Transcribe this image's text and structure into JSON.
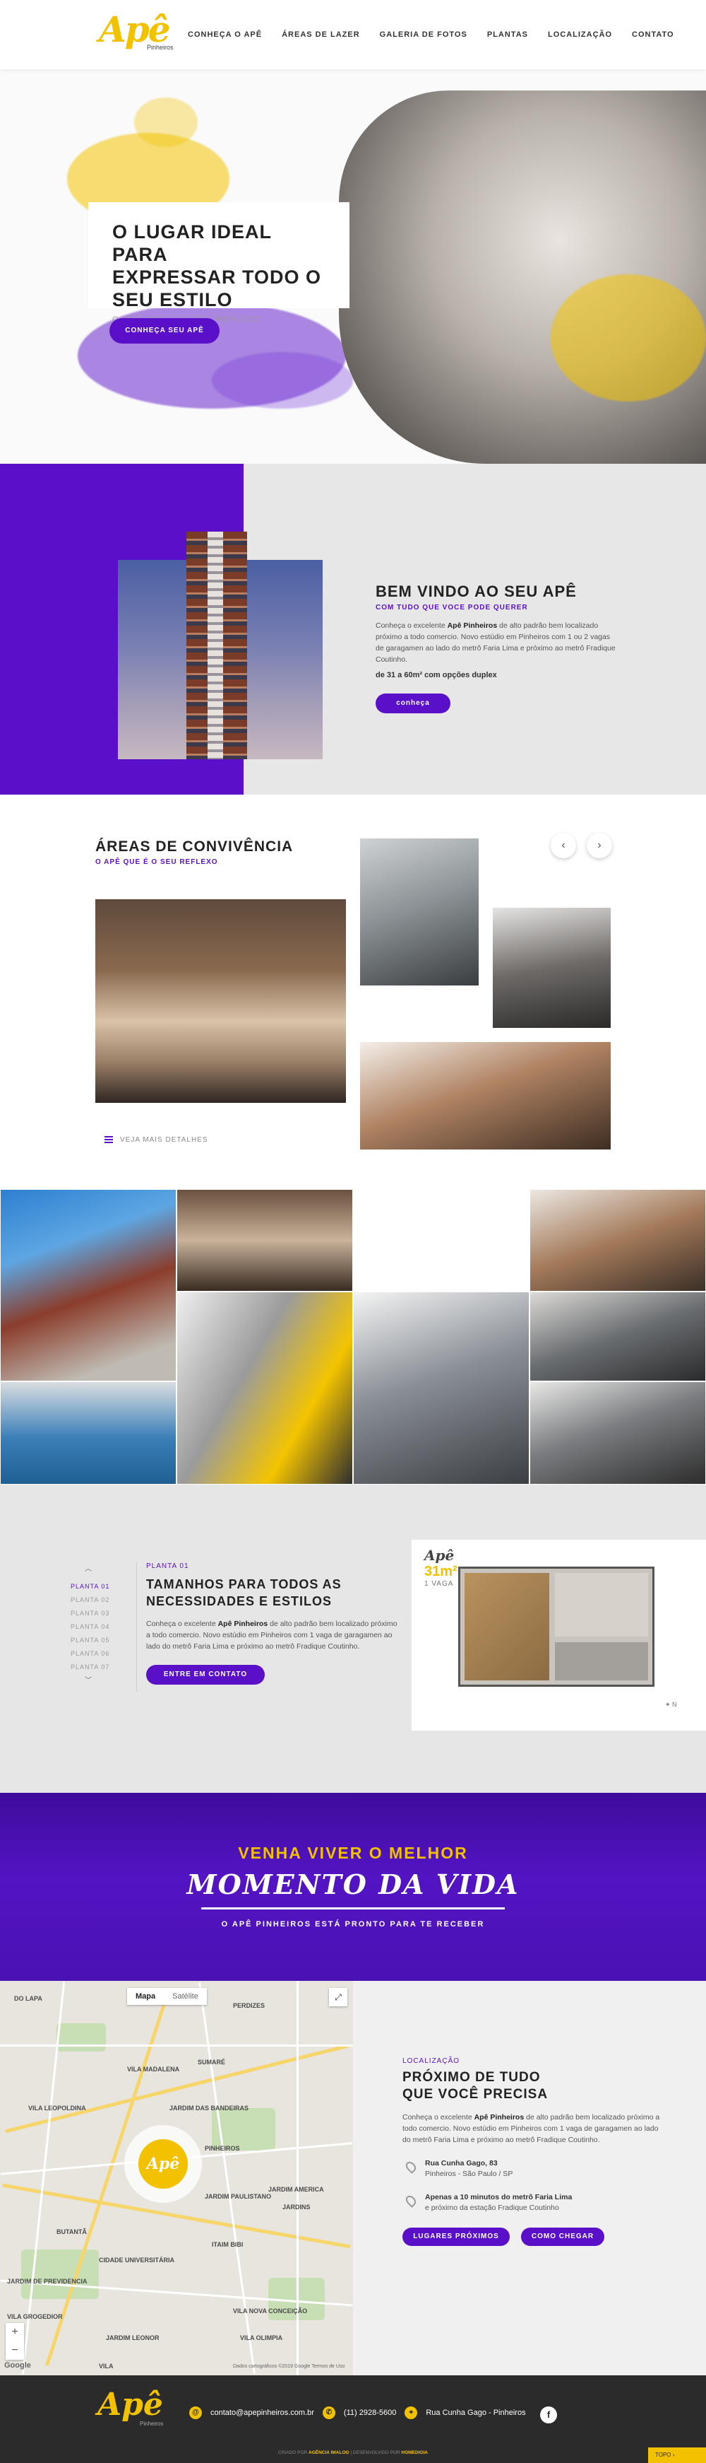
{
  "brand": {
    "logo": "Apê",
    "logo_sub": "Pinheiros"
  },
  "nav": [
    "CONHEÇA O APÊ",
    "ÁREAS DE LAZER",
    "GALERIA DE FOTOS",
    "PLANTAS",
    "LOCALIZAÇÃO",
    "CONTATO"
  ],
  "hero": {
    "title": "O LUGAR IDEAL PARA\nEXPRESSAR TODO O\nSEU ESTILO",
    "tagline": "O APÊ QUE É O SEU REFLEXO",
    "button": "CONHEÇA SEU APÊ"
  },
  "welcome": {
    "title": "BEM VINDO AO SEU APÊ",
    "subtitle": "COM TUDO QUE VOCE PODE QUERER",
    "text_before": "Conheça o excelente ",
    "text_bold": "Apê Pinheiros",
    "text_after": " de alto padrão bem localizado próximo a todo comercio. Novo estúdio em Pinheiros com 1 ou 2 vagas de garagamen ao lado do metrô Faria Lima e próximo ao metrô Fradique Coutinho.",
    "sizes": "de 31 a 60m² com opções duplex",
    "button": "conheça"
  },
  "areas": {
    "title": "ÁREAS DE CONVIVÊNCIA",
    "subtitle": "O APÊ QUE É O SEU REFLEXO",
    "details_link": "VEJA MAIS DETALHES",
    "prev_icon": "‹",
    "next_icon": "›"
  },
  "plants": {
    "up_icon": "︿",
    "down_icon": "﹀",
    "list": [
      "PLANTA 01",
      "PLANTA 02",
      "PLANTA 03",
      "PLANTA 04",
      "PLANTA 05",
      "PLANTA 06",
      "PLANTA 07"
    ],
    "kicker": "PLANTA 01",
    "title": "TAMANHOS PARA TODOS AS\nNECESSIDADES E ESTILOS",
    "text_before": "Conheça o excelente ",
    "text_bold": "Apê Pinheiros",
    "text_after": " de alto padrão bem localizado próximo a todo comercio. Novo estúdio em Pinheiros com 1 vaga de garagamen ao lado do metrô Faria Lima e próximo ao metrô Fradique Coutinho.",
    "button": "ENTRE EM CONTATO",
    "plan_logo": "Apê",
    "plan_area": "31m²",
    "plan_vaga": "1 VAGA"
  },
  "banner": {
    "line1": "VENHA VIVER O MELHOR",
    "line2": "MOMENTO DA VIDA",
    "line3": "O APÊ PINHEIROS ESTÁ PRONTO PARA TE RECEBER"
  },
  "map": {
    "tab_map": "Mapa",
    "tab_satellite": "Satélite",
    "fullscreen_icon": "⤢",
    "zoom_in": "+",
    "zoom_out": "−",
    "google": "Google",
    "terms": "Dados cartográficos ©2019 Google  Termos de Uso",
    "pin_logo": "Apê",
    "labels": [
      "DO LAPA",
      "VILA LEOPOLDINA",
      "PERDIZES",
      "SUMARÉ",
      "JARDIM DAS BANDEIRAS",
      "PINHEIROS",
      "JARDIM PAULISTANO",
      "JARDIM AMERICA",
      "JARDINS",
      "BUTANTÃ",
      "ITAIM BIBI",
      "VILA NOVA CONCEIÇÃO",
      "VILA OLIMPIA",
      "VILA GROGEDIOR",
      "JARDIM LEONOR",
      "CIDADE UNIVERSITÁRIA",
      "JARDIM DE PREVIDENCIA",
      "VILA MADALENA",
      "VILA"
    ]
  },
  "location": {
    "kicker": "LOCALIZAÇÃO",
    "title": "PRÓXIMO DE TUDO\nQUE VOCÊ PRECISA",
    "text_before": "Conheça o excelente ",
    "text_bold": "Apê Pinheiros",
    "text_after": " de alto padrão bem localizado próximo a todo comercio. Novo estúdio em Pinheiros com 1 vaga de garagamen ao lado do metrô Faria Lima e próximo ao metrô Fradique Coutinho.",
    "address_bold": "Rua Cunha Gago, 83",
    "address": "Pinheiros - São Paulo / SP",
    "metro_bold": "Apenas a 10 minutos do metrô Faria Lima",
    "metro": "e próximo da estação Fradique Coutinho",
    "btn_places": "LUGARES PRÓXIMOS",
    "btn_route": "COMO CHEGAR"
  },
  "footer": {
    "logo": "Apê",
    "logo_sub": "Pinheiros",
    "email": "contato@apepinheiros.com.br",
    "phone": "(11) 2928-5600",
    "address": "Rua Cunha Gago - Pinheiros",
    "facebook_icon": "f",
    "credit_before": "CRIADO POR ",
    "credit_agency": "AGÊNCIA IMALOG",
    "credit_mid": " | DESENVOLVIDO POR ",
    "credit_dev": "HOMEDIGIA",
    "top_button": "TOPO ›"
  }
}
